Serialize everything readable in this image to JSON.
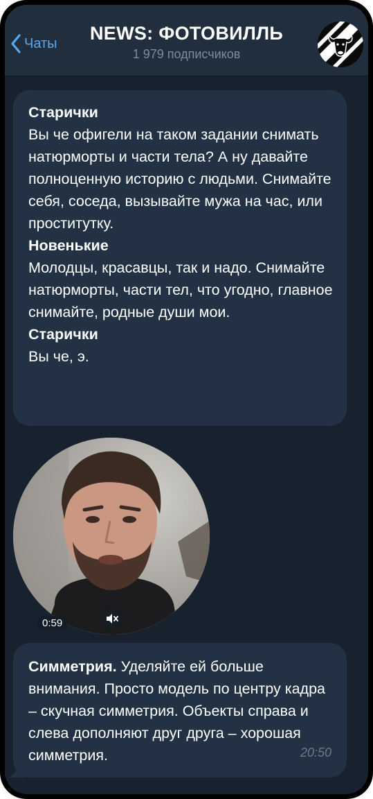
{
  "header": {
    "back_label": "Чаты",
    "title": "NEWS: ФОТОВИЛЛЬ",
    "subtitle": "1 979 подписчиков",
    "avatar_icon": "bull-logo-icon"
  },
  "messages": [
    {
      "type": "text",
      "blocks": [
        {
          "heading": "Старички",
          "text": "Вы че офигели на таком задании снимать натюрморты и части тела? А ну давайте полноценную историю с людьми. Снимайте себя, соседа, вызывайте мужа на час, или проститутку."
        },
        {
          "heading": "Новенькие",
          "text": "Молодцы, красавцы, так и надо. Снимайте натюрморты, части тел, что угодно, главное снимайте, родные души мои."
        },
        {
          "heading": "Старички",
          "text": "Вы че, э."
        }
      ]
    },
    {
      "type": "video_note",
      "duration": "0:59",
      "muted_icon": "speaker-muted-icon"
    },
    {
      "type": "text",
      "bold_lead": "Симметрия.",
      "text": " Уделяйте ей больше внимания. Просто модель по центру кадра – скучная симметрия. Объекты справа и слева дополняют друг друга – хорошая симметрия.",
      "time": "20:50"
    }
  ],
  "colors": {
    "background": "#17222e",
    "header": "#212e3d",
    "bubble": "#223244",
    "accent": "#5aa9ee",
    "muted_text": "#7f8c99"
  }
}
